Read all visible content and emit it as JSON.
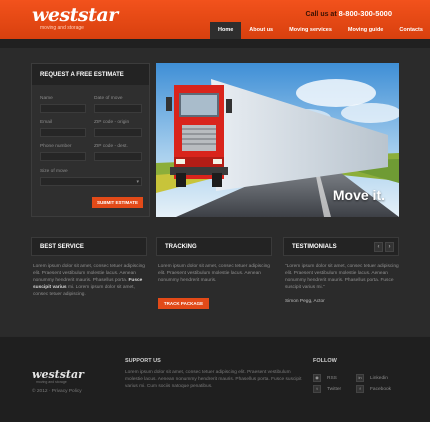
{
  "header": {
    "logo": "weststar",
    "tagline": "moving and storage",
    "call_label": "Call us at",
    "phone": "8-800-300-5000",
    "nav": [
      "Home",
      "About us",
      "Moving services",
      "Moving guide",
      "Contacts"
    ],
    "active_nav": "Home"
  },
  "estimate": {
    "title": "REQUEST A FREE ESTIMATE",
    "fields": {
      "name": "Name",
      "date_of_move": "Date of move",
      "email": "Email",
      "zip_origin": "ZIP code - origin",
      "phone": "Phone number",
      "zip_dest": "ZIP code - dest.",
      "size_of_move": "Size of move"
    },
    "submit": "SUBMIT ESTIMATE"
  },
  "hero": {
    "caption": "Move it."
  },
  "best_service": {
    "title": "BEST SERVICE",
    "line1": "Lorem ipsum dolor sit amet, consec tetuer adipiscing elit. Praesent vestibulum molestie lacus. Aenean nonummy hendrerit mauris. Phasellus porta.",
    "bold": "Fusce suscipit varius",
    "line2": "mi. Lorem ipsum dolor sit amet, consec tetuer adipiscing."
  },
  "tracking": {
    "title": "TRACKING",
    "text": "Lorem ipsum dolor sit amet, consec tetuer adipiscing elit. Praesent vestibulum molestie lacus. Aenean nonummy hendrerit mauris.",
    "button": "TRACK PACKAGE"
  },
  "testimonials": {
    "title": "TESTIMONIALS",
    "prev": "‹",
    "next": "›",
    "text": "\"Lorem ipsum dolor sit amet, consec tetuer adipiscing elit. Praesent vestibulum molestie lacus. Aenean nonummy hendrerit mauris. Phasellus porta. Fusce suscipit varius mi.\"",
    "author": "Simon Pegg, Actor"
  },
  "footer": {
    "logo": "weststar",
    "tagline": "moving and storage",
    "copyright": "© 2012 · Privacy Policy",
    "support_title": "SUPPORT US",
    "support_text": "Lorem ipsum dolor sit amet, consec tetuer adipiscing elit. Praesent vestibulum molestie lacus. Aenean nonummy hendrerit mauris. Phasellus porta. Fusce suscipit varius mi. Cum sociis natoque penatibus.",
    "follow_title": "FOLLOW",
    "links": [
      "RSS",
      "Linkedin",
      "Twitter",
      "Facebook"
    ]
  },
  "colors": {
    "accent": "#e24a18",
    "header": "#f2521c",
    "bg": "#2b2b2b"
  }
}
